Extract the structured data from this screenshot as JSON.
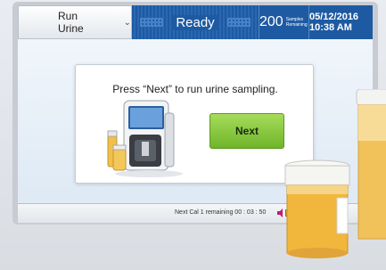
{
  "topbar": {
    "mode_label": "Run Urine",
    "status": "Ready",
    "samples_count": "200",
    "samples_label": "Samples Remaining",
    "datetime": "05/12/2016 10:38 AM"
  },
  "dialog": {
    "prompt": "Press “Next” to run urine sampling.",
    "next_label": "Next"
  },
  "footer": {
    "calibration": "Next Cal 1 remaining 00 : 03 : 50"
  },
  "colors": {
    "header_blue": "#1d5aa2",
    "next_green": "#7cc133",
    "urine_amber": "#e8b33a"
  },
  "icons": [
    "chevron-down-icon",
    "speaker-icon",
    "printer-icon"
  ]
}
